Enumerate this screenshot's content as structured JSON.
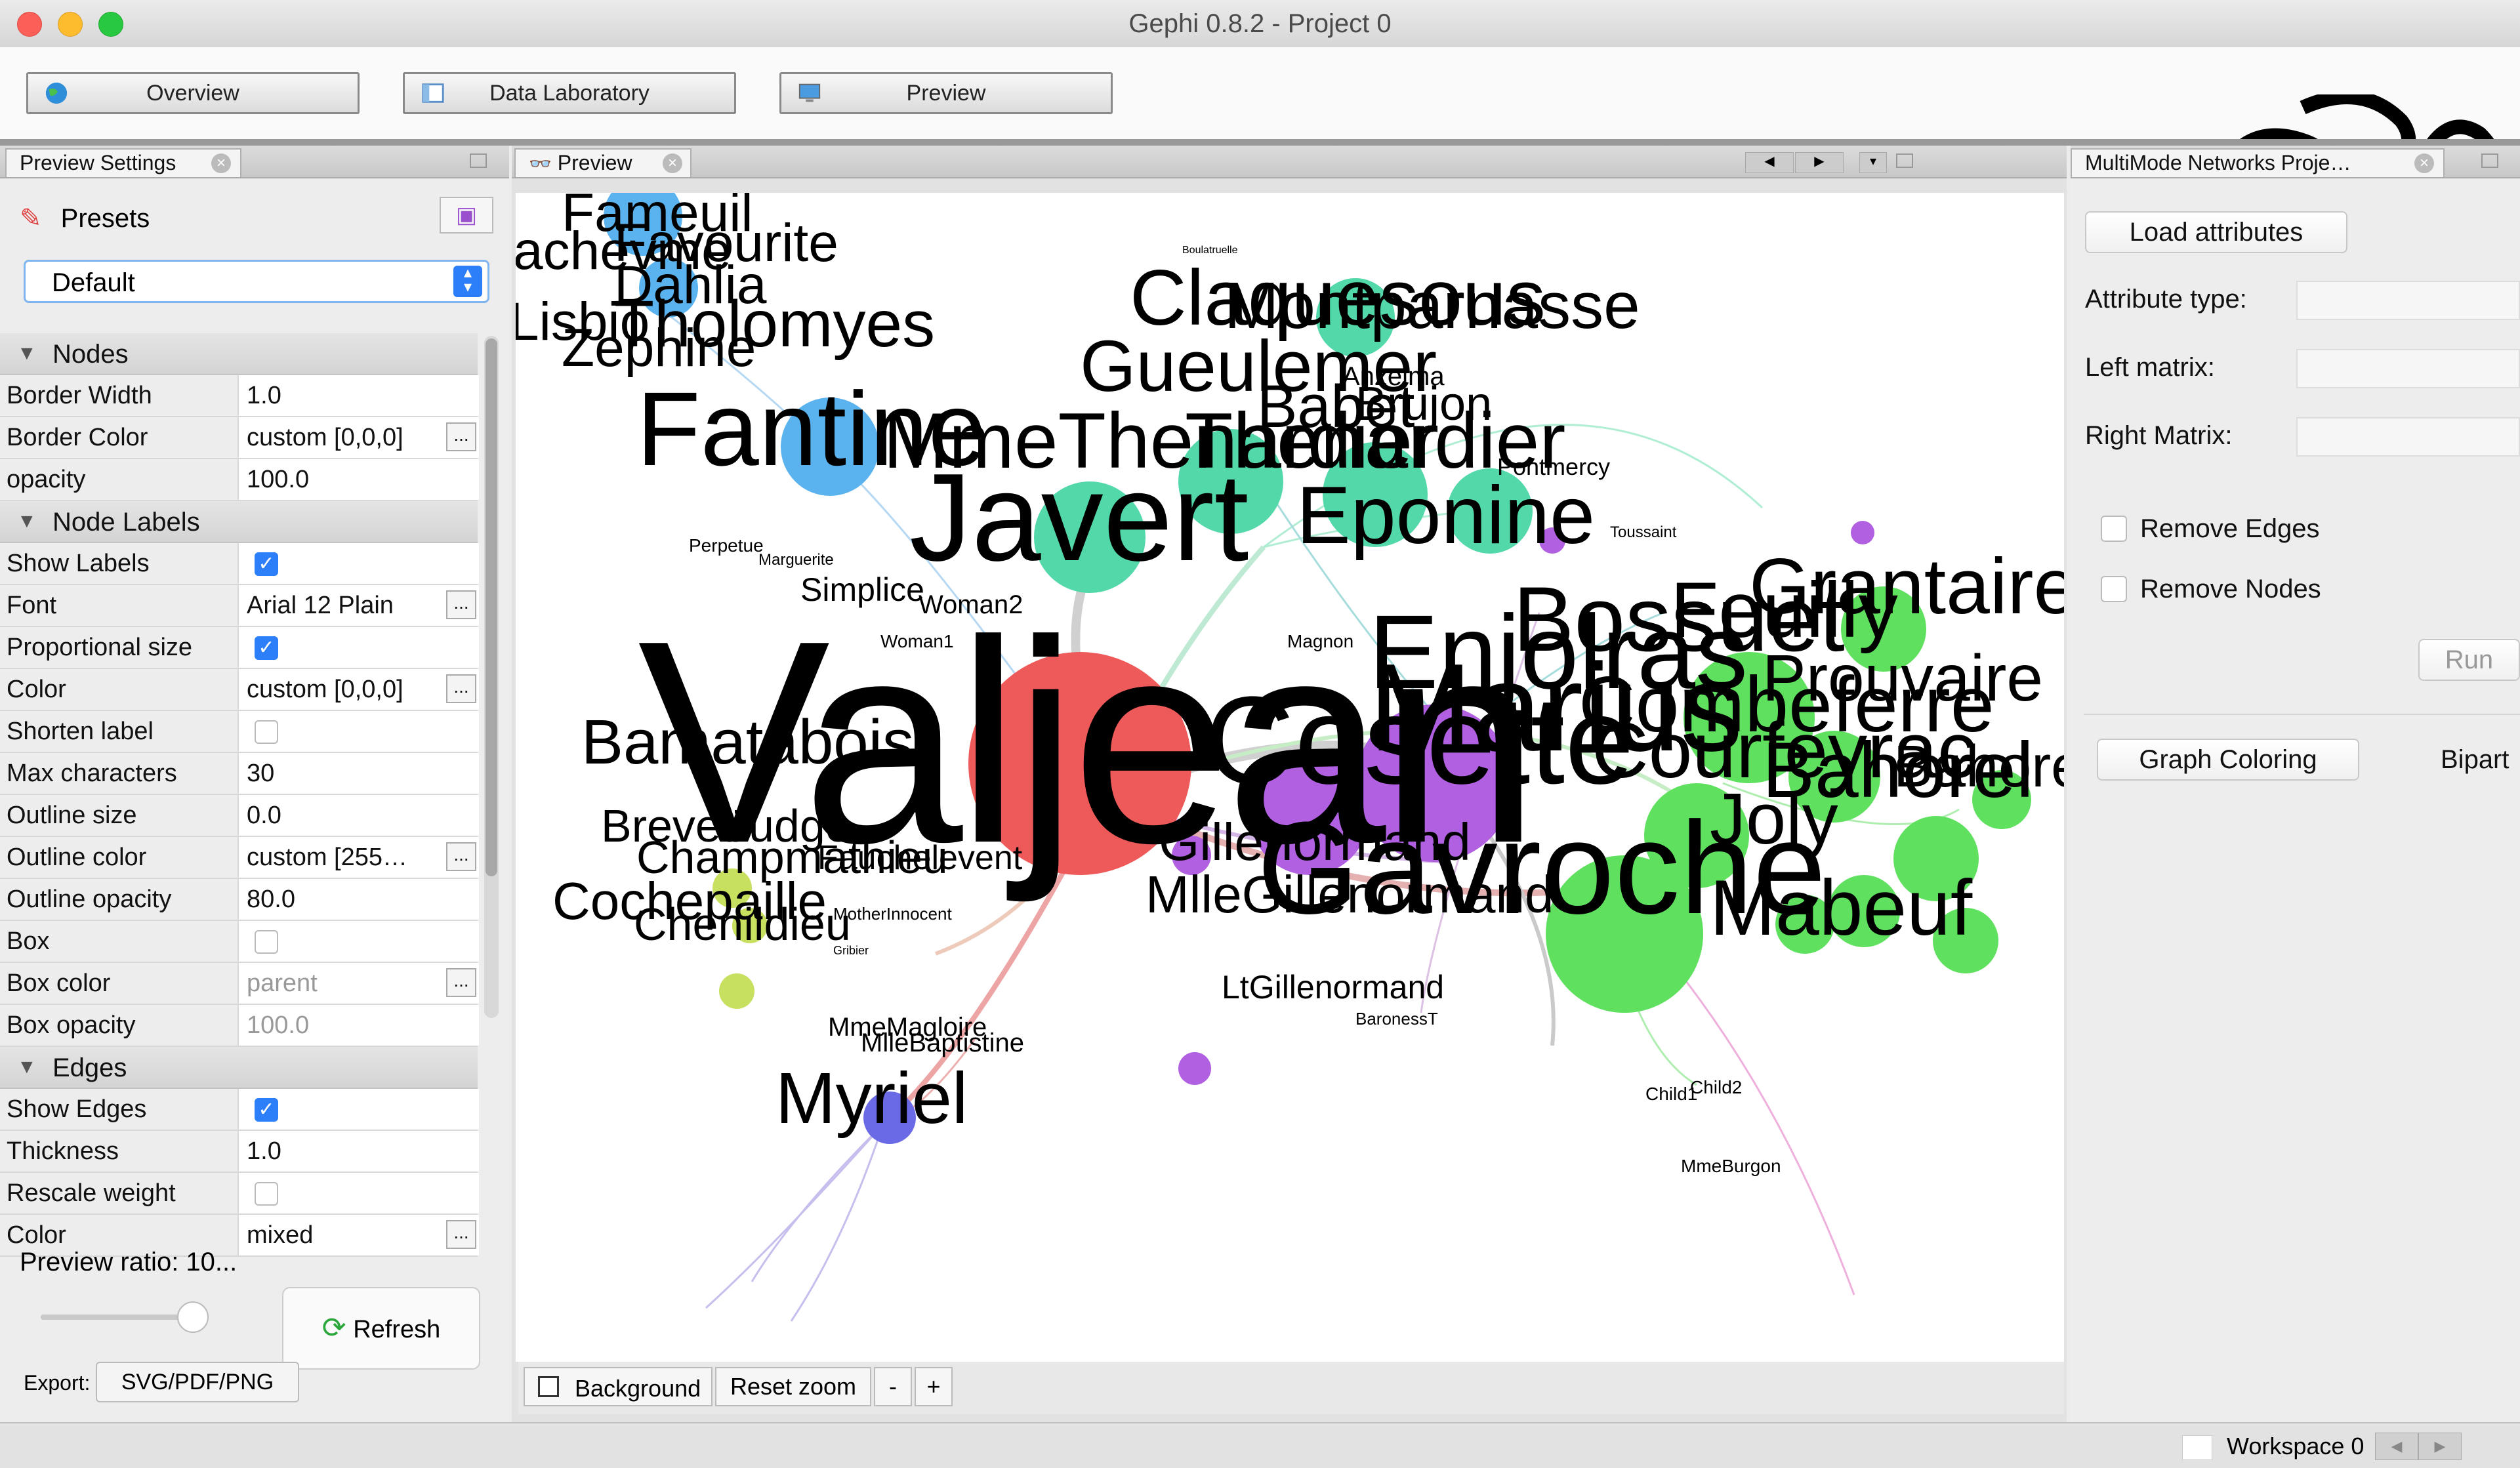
{
  "window": {
    "title": "Gephi 0.8.2 - Project 0"
  },
  "toolbar": {
    "overview": "Overview",
    "data_lab": "Data Laboratory",
    "preview": "Preview"
  },
  "left": {
    "tab_label": "Preview Settings",
    "presets_label": "Presets",
    "preset_value": "Default",
    "sections": {
      "nodes": "Nodes",
      "node_labels": "Node Labels",
      "edges": "Edges"
    },
    "rows": {
      "border_width": {
        "label": "Border Width",
        "value": "1.0"
      },
      "border_color": {
        "label": "Border Color",
        "value": "custom [0,0,0]"
      },
      "opacity": {
        "label": "opacity",
        "value": "100.0"
      },
      "show_labels": {
        "label": "Show Labels",
        "checked": true
      },
      "font": {
        "label": "Font",
        "value": "Arial 12 Plain"
      },
      "proportional_size": {
        "label": "Proportional size",
        "checked": true
      },
      "color": {
        "label": "Color",
        "value": "custom [0,0,0]"
      },
      "shorten_label": {
        "label": "Shorten label",
        "checked": false
      },
      "max_characters": {
        "label": "Max characters",
        "value": "30"
      },
      "outline_size": {
        "label": "Outline size",
        "value": "0.0"
      },
      "outline_color": {
        "label": "Outline color",
        "value": "custom [255…"
      },
      "outline_opacity": {
        "label": "Outline opacity",
        "value": "80.0"
      },
      "box": {
        "label": "Box",
        "checked": false
      },
      "box_color": {
        "label": "Box color",
        "value": "parent"
      },
      "box_opacity": {
        "label": "Box opacity",
        "value": "100.0"
      },
      "show_edges": {
        "label": "Show Edges",
        "checked": true
      },
      "thickness": {
        "label": "Thickness",
        "value": "1.0"
      },
      "rescale_weight": {
        "label": "Rescale weight",
        "checked": false
      },
      "edge_color": {
        "label": "Color",
        "value": "mixed"
      }
    },
    "preview_ratio": "Preview ratio: 10...",
    "refresh": "Refresh",
    "export_label": "Export:",
    "export_button": "SVG/PDF/PNG"
  },
  "center": {
    "tab_label": "Preview",
    "background": "Background",
    "reset_zoom": "Reset zoom",
    "zoom_out": "-",
    "zoom_in": "+",
    "graph_labels": {
      "fameuil": "Fameuil",
      "favourite": "Favourite",
      "acheveme": "achevme",
      "dahlia": "Dahlia",
      "tholomyes": "Tholomyes",
      "listolier": "Lisbio",
      "zephine": "Zephine",
      "fantine": "Fantine",
      "mmethenardier": "MmeThenardier",
      "thenardier": "Thenardier",
      "javert": "Javert",
      "eponine": "Eponine",
      "claquesous": "Claquesous",
      "montparnasse": "Montparnasse",
      "gueulemer": "Gueulemer",
      "babet": "Babet",
      "brujon": "Brujon",
      "anzelma": "Anzelma",
      "pontmercy": "Pontmercy",
      "perpetue": "Perpetue",
      "marguerite": "Marguerite",
      "simplice": "Simplice",
      "woman2": "Woman2",
      "woman1": "Woman1",
      "valjean": "Valjean",
      "marius": "Marius",
      "cosette": "Cosette",
      "enjolras": "Enjolras",
      "bossuet": "Bossuet",
      "grantaire": "Grantaire",
      "feuilly": "Feuilly",
      "prouvaire": "Prouvaire",
      "combeferre": "Combeferre",
      "courfeyrac": "Courfeyrac",
      "bahorel": "Bahorel",
      "mabeuf": "Mabeuf",
      "joly": "Joly",
      "gavroche": "Gavroche",
      "magnon": "Magnon",
      "bamatabois": "Bamatabois",
      "brevet": "Brevet",
      "judge": "Judge",
      "champmathieu": "Champmathieu",
      "fauchelevent": "Fauchelevent",
      "cochepaille": "Cochepaille",
      "chenildieu": "Chenildieu",
      "motherinnocent": "MotherInnocent",
      "gribier": "Gribier",
      "gillenormand": "Gillenormand",
      "mllegillenormand": "MlleGillenormand",
      "ltgillenormand": "LtGillenormand",
      "baronesst": "BaronessT",
      "mmemagloire": "MmeMagloire",
      "mllebaptistine": "MlleBaptistine",
      "myriel": "Myriel",
      "child1": "Child1",
      "child2": "Child2",
      "mmeburgon": "MmeBurgon",
      "boulatruelle": "Boulatruelle",
      "toussaint": "Toussaint"
    }
  },
  "right": {
    "tab_label": "MultiMode Networks Proje…",
    "load_attributes": "Load attributes",
    "attribute_type": "Attribute type:",
    "left_matrix": "Left matrix:",
    "right_matrix": "Right Matrix:",
    "remove_edges": "Remove Edges",
    "remove_nodes": "Remove Nodes",
    "run": "Run",
    "graph_coloring": "Graph Coloring",
    "bipart": "Bipart"
  },
  "status": {
    "workspace": "Workspace 0"
  },
  "colors": {
    "accent": "#2d7ff9",
    "node_red": "#ee5a5a",
    "node_teal": "#53d8a9",
    "node_blue": "#5ab3ee",
    "node_green": "#5fe05f",
    "node_purple": "#b060e0"
  }
}
